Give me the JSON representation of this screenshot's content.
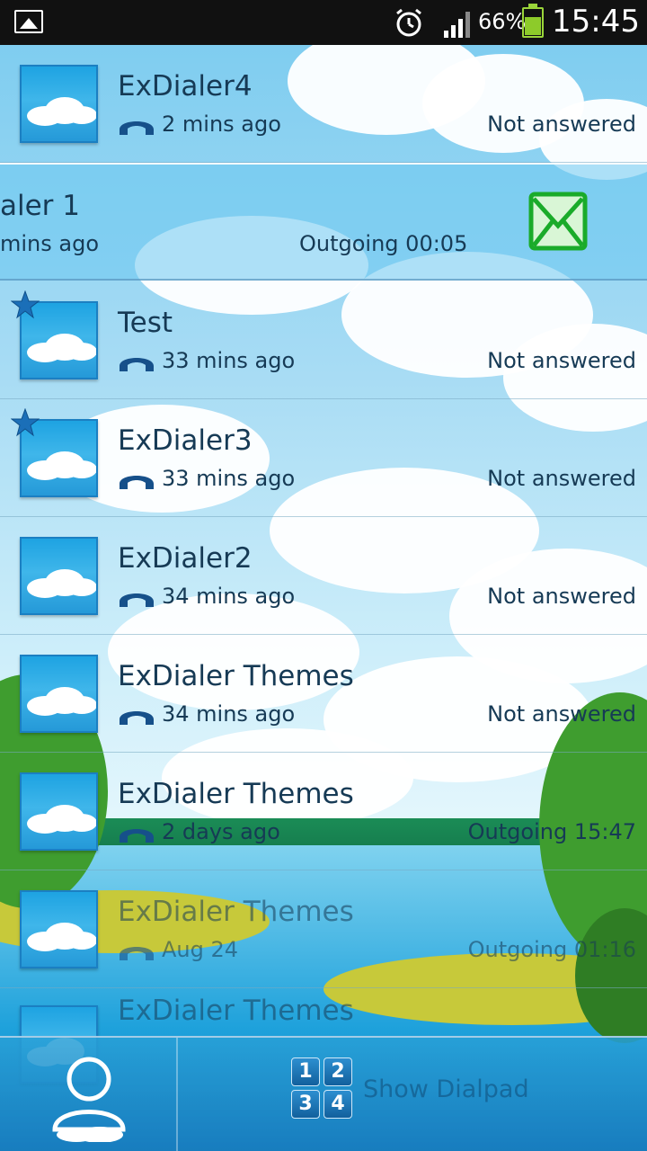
{
  "status_bar": {
    "battery_percent": "66%",
    "clock": "15:45",
    "icons": [
      "gallery-icon",
      "alarm-icon",
      "signal-icon",
      "battery-icon"
    ]
  },
  "call_log": [
    {
      "name": "ExDialer4",
      "time": "2 mins ago",
      "status": "Not answered",
      "starred": false
    },
    {
      "name": "aler 1",
      "time": "mins ago",
      "status": "Outgoing 00:05",
      "starred": false,
      "swiped": true
    },
    {
      "name": "Test",
      "time": "33 mins ago",
      "status": "Not answered",
      "starred": true
    },
    {
      "name": "ExDialer3",
      "time": "33 mins ago",
      "status": "Not answered",
      "starred": true
    },
    {
      "name": "ExDialer2",
      "time": "34 mins ago",
      "status": "Not answered",
      "starred": false
    },
    {
      "name": "ExDialer Themes",
      "time": "34 mins ago",
      "status": "Not answered",
      "starred": false
    },
    {
      "name": "ExDialer Themes",
      "time": "2 days ago",
      "status": "Outgoing 15:47",
      "starred": false
    },
    {
      "name": "ExDialer Themes",
      "time": "Aug 24",
      "status": "Outgoing 01:16",
      "starred": false
    },
    {
      "name": "ExDialer Themes",
      "time": "",
      "status": "",
      "starred": false
    }
  ],
  "bottom_bar": {
    "dialpad_label": "Show Dialpad",
    "dialpad_keys": [
      "1",
      "2",
      "3",
      "4"
    ]
  },
  "colors": {
    "text": "#163a55",
    "avatar_blue": "#1ea3e2",
    "sms_green": "#1aab2a",
    "phone_icon": "#16508a"
  }
}
